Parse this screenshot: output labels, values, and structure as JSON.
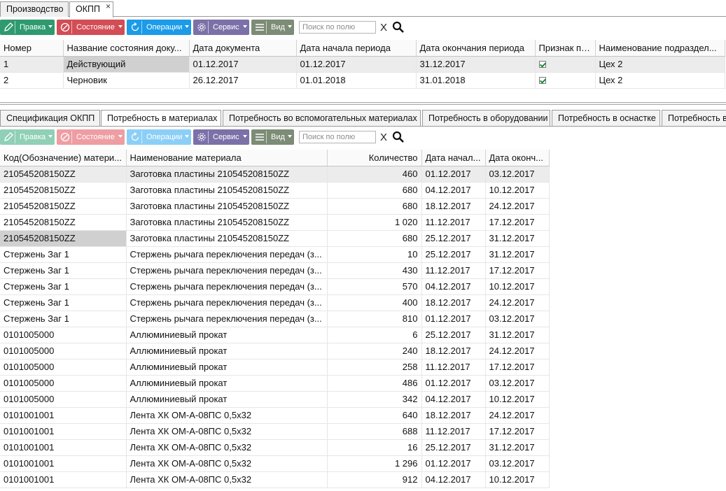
{
  "top_tabs": [
    {
      "label": "Производство"
    },
    {
      "label": "ОКПП",
      "close": "×"
    }
  ],
  "toolbar": {
    "edit": "Правка",
    "state": "Состояние",
    "operations": "Операции",
    "service": "Сервис",
    "view": "Вид",
    "search_placeholder": "Поиск по полю",
    "clear": "X"
  },
  "doc_grid": {
    "headers": [
      "Номер",
      "Название состояния доку...",
      "Дата документа",
      "Дата начала периода",
      "Дата окончания периода",
      "Признак пр...",
      "Наименование подраздел..."
    ],
    "rows": [
      {
        "num": "1",
        "state": "Действующий",
        "doc_date": "01.12.2017",
        "start": "01.12.2017",
        "end": "31.12.2017",
        "flag": true,
        "dept": "Цех 2"
      },
      {
        "num": "2",
        "state": "Черновик",
        "doc_date": "26.12.2017",
        "start": "01.01.2018",
        "end": "31.01.2018",
        "flag": true,
        "dept": "Цех 2"
      }
    ]
  },
  "sub_tabs": [
    {
      "label": "Спецификация ОКПП"
    },
    {
      "label": "Потребность в материалах"
    },
    {
      "label": "Потребность во вспомогательных материалах"
    },
    {
      "label": "Потребность в оборудовании"
    },
    {
      "label": "Потребность в оснастке"
    },
    {
      "label": "Потребность в"
    }
  ],
  "mat_grid": {
    "headers": [
      "Код(Обозначение) матери...",
      "Наименование материала",
      "Количество",
      "Дата начал...",
      "Дата оконч..."
    ],
    "rows": [
      [
        "210545208150ZZ",
        "Заготовка пластины 210545208150ZZ",
        "460",
        "01.12.2017",
        "03.12.2017"
      ],
      [
        "210545208150ZZ",
        "Заготовка пластины 210545208150ZZ",
        "680",
        "04.12.2017",
        "10.12.2017"
      ],
      [
        "210545208150ZZ",
        "Заготовка пластины 210545208150ZZ",
        "680",
        "18.12.2017",
        "24.12.2017"
      ],
      [
        "210545208150ZZ",
        "Заготовка пластины 210545208150ZZ",
        "1 020",
        "11.12.2017",
        "17.12.2017"
      ],
      [
        "210545208150ZZ",
        "Заготовка пластины 210545208150ZZ",
        "680",
        "25.12.2017",
        "31.12.2017"
      ],
      [
        "Стержень Заг 1",
        "Стержень рычага переключения передач (з...",
        "10",
        "25.12.2017",
        "31.12.2017"
      ],
      [
        "Стержень Заг 1",
        "Стержень рычага переключения передач (з...",
        "430",
        "11.12.2017",
        "17.12.2017"
      ],
      [
        "Стержень Заг 1",
        "Стержень рычага переключения передач (з...",
        "570",
        "04.12.2017",
        "10.12.2017"
      ],
      [
        "Стержень Заг 1",
        "Стержень рычага переключения передач (з...",
        "400",
        "18.12.2017",
        "24.12.2017"
      ],
      [
        "Стержень Заг 1",
        "Стержень рычага переключения передач (з...",
        "810",
        "01.12.2017",
        "03.12.2017"
      ],
      [
        "0101005000",
        "Аллюминиевый прокат",
        "6",
        "25.12.2017",
        "31.12.2017"
      ],
      [
        "0101005000",
        "Аллюминиевый прокат",
        "240",
        "18.12.2017",
        "24.12.2017"
      ],
      [
        "0101005000",
        "Аллюминиевый прокат",
        "258",
        "11.12.2017",
        "17.12.2017"
      ],
      [
        "0101005000",
        "Аллюминиевый прокат",
        "486",
        "01.12.2017",
        "03.12.2017"
      ],
      [
        "0101005000",
        "Аллюминиевый прокат",
        "342",
        "04.12.2017",
        "10.12.2017"
      ],
      [
        "0101001001",
        "Лента ХК ОМ-А-08ПС 0,5х32",
        "640",
        "18.12.2017",
        "24.12.2017"
      ],
      [
        "0101001001",
        "Лента ХК ОМ-А-08ПС 0,5х32",
        "688",
        "11.12.2017",
        "17.12.2017"
      ],
      [
        "0101001001",
        "Лента ХК ОМ-А-08ПС 0,5х32",
        "16",
        "25.12.2017",
        "31.12.2017"
      ],
      [
        "0101001001",
        "Лента ХК ОМ-А-08ПС 0,5х32",
        "1 296",
        "01.12.2017",
        "03.12.2017"
      ],
      [
        "0101001001",
        "Лента ХК ОМ-А-08ПС 0,5х32",
        "912",
        "04.12.2017",
        "10.12.2017"
      ]
    ]
  }
}
